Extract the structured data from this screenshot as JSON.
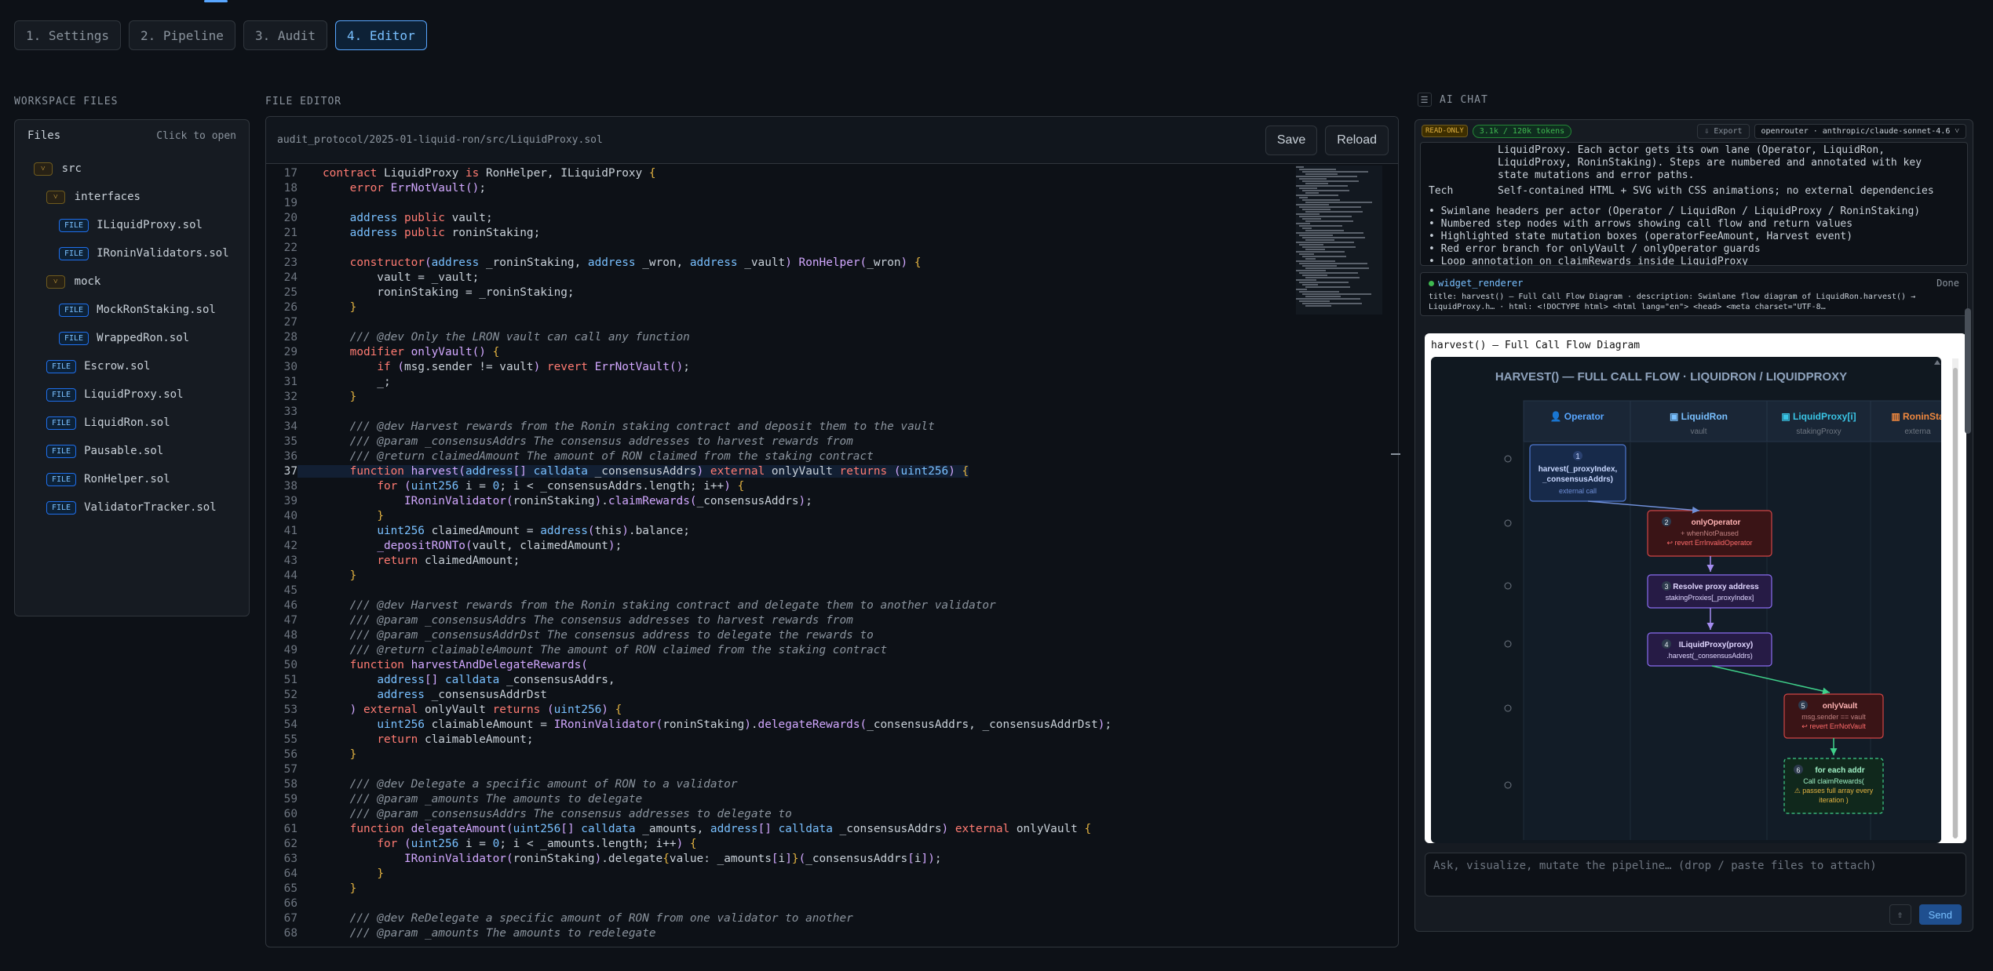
{
  "tabs": [
    "1. Settings",
    "2. Pipeline",
    "3. Audit",
    "4. Editor"
  ],
  "active_tab": 3,
  "workspace": {
    "label": "WORKSPACE FILES",
    "title": "Files",
    "hint": "Click to open",
    "tree": [
      {
        "name": "src",
        "kind": "dir",
        "depth": 0
      },
      {
        "name": "interfaces",
        "kind": "dir",
        "depth": 1
      },
      {
        "name": "ILiquidProxy.sol",
        "kind": "file",
        "depth": 2
      },
      {
        "name": "IRoninValidators.sol",
        "kind": "file",
        "depth": 2
      },
      {
        "name": "mock",
        "kind": "dir",
        "depth": 1
      },
      {
        "name": "MockRonStaking.sol",
        "kind": "file",
        "depth": 2
      },
      {
        "name": "WrappedRon.sol",
        "kind": "file",
        "depth": 2
      },
      {
        "name": "Escrow.sol",
        "kind": "file",
        "depth": 1
      },
      {
        "name": "LiquidProxy.sol",
        "kind": "file",
        "depth": 1
      },
      {
        "name": "LiquidRon.sol",
        "kind": "file",
        "depth": 1
      },
      {
        "name": "Pausable.sol",
        "kind": "file",
        "depth": 1
      },
      {
        "name": "RonHelper.sol",
        "kind": "file",
        "depth": 1
      },
      {
        "name": "ValidatorTracker.sol",
        "kind": "file",
        "depth": 1
      }
    ],
    "file_badge": "FILE",
    "dir_badge": "˅"
  },
  "editor": {
    "label": "FILE EDITOR",
    "path": "audit_protocol/2025-01-liquid-ron/src/LiquidProxy.sol",
    "save": "Save",
    "reload": "Reload",
    "current_line": 37,
    "lines": [
      {
        "n": 17,
        "t": "contract LiquidProxy is RonHelper, ILiquidProxy {"
      },
      {
        "n": 18,
        "t": "    error ErrNotVault();"
      },
      {
        "n": 19,
        "t": ""
      },
      {
        "n": 20,
        "t": "    address public vault;"
      },
      {
        "n": 21,
        "t": "    address public roninStaking;"
      },
      {
        "n": 22,
        "t": ""
      },
      {
        "n": 23,
        "t": "    constructor(address _roninStaking, address _wron, address _vault) RonHelper(_wron) {"
      },
      {
        "n": 24,
        "t": "        vault = _vault;"
      },
      {
        "n": 25,
        "t": "        roninStaking = _roninStaking;"
      },
      {
        "n": 26,
        "t": "    }"
      },
      {
        "n": 27,
        "t": ""
      },
      {
        "n": 28,
        "t": "    /// @dev Only the LRON vault can call any function"
      },
      {
        "n": 29,
        "t": "    modifier onlyVault() {"
      },
      {
        "n": 30,
        "t": "        if (msg.sender != vault) revert ErrNotVault();"
      },
      {
        "n": 31,
        "t": "        _;"
      },
      {
        "n": 32,
        "t": "    }"
      },
      {
        "n": 33,
        "t": ""
      },
      {
        "n": 34,
        "t": "    /// @dev Harvest rewards from the Ronin staking contract and deposit them to the vault"
      },
      {
        "n": 35,
        "t": "    /// @param _consensusAddrs The consensus addresses to harvest rewards from"
      },
      {
        "n": 36,
        "t": "    /// @return claimedAmount The amount of RON claimed from the staking contract"
      },
      {
        "n": 37,
        "t": "    function harvest(address[] calldata _consensusAddrs) external onlyVault returns (uint256) {"
      },
      {
        "n": 38,
        "t": "        for (uint256 i = 0; i < _consensusAddrs.length; i++) {"
      },
      {
        "n": 39,
        "t": "            IRoninValidator(roninStaking).claimRewards(_consensusAddrs);"
      },
      {
        "n": 40,
        "t": "        }"
      },
      {
        "n": 41,
        "t": "        uint256 claimedAmount = address(this).balance;"
      },
      {
        "n": 42,
        "t": "        _depositRONTo(vault, claimedAmount);"
      },
      {
        "n": 43,
        "t": "        return claimedAmount;"
      },
      {
        "n": 44,
        "t": "    }"
      },
      {
        "n": 45,
        "t": ""
      },
      {
        "n": 46,
        "t": "    /// @dev Harvest rewards from the Ronin staking contract and delegate them to another validator"
      },
      {
        "n": 47,
        "t": "    /// @param _consensusAddrs The consensus addresses to harvest rewards from"
      },
      {
        "n": 48,
        "t": "    /// @param _consensusAddrDst The consensus address to delegate the rewards to"
      },
      {
        "n": 49,
        "t": "    /// @return claimableAmount The amount of RON claimed from the staking contract"
      },
      {
        "n": 50,
        "t": "    function harvestAndDelegateRewards("
      },
      {
        "n": 51,
        "t": "        address[] calldata _consensusAddrs,"
      },
      {
        "n": 52,
        "t": "        address _consensusAddrDst"
      },
      {
        "n": 53,
        "t": "    ) external onlyVault returns (uint256) {"
      },
      {
        "n": 54,
        "t": "        uint256 claimableAmount = IRoninValidator(roninStaking).delegateRewards(_consensusAddrs, _consensusAddrDst);"
      },
      {
        "n": 55,
        "t": "        return claimableAmount;"
      },
      {
        "n": 56,
        "t": "    }"
      },
      {
        "n": 57,
        "t": ""
      },
      {
        "n": 58,
        "t": "    /// @dev Delegate a specific amount of RON to a validator"
      },
      {
        "n": 59,
        "t": "    /// @param _amounts The amounts to delegate"
      },
      {
        "n": 60,
        "t": "    /// @param _consensusAddrs The consensus addresses to delegate to"
      },
      {
        "n": 61,
        "t": "    function delegateAmount(uint256[] calldata _amounts, address[] calldata _consensusAddrs) external onlyVault {"
      },
      {
        "n": 62,
        "t": "        for (uint256 i = 0; i < _amounts.length; i++) {"
      },
      {
        "n": 63,
        "t": "            IRoninValidator(roninStaking).delegate{value: _amounts[i]}(_consensusAddrs[i]);"
      },
      {
        "n": 64,
        "t": "        }"
      },
      {
        "n": 65,
        "t": "    }"
      },
      {
        "n": 66,
        "t": ""
      },
      {
        "n": 67,
        "t": "    /// @dev ReDelegate a specific amount of RON from one validator to another"
      },
      {
        "n": 68,
        "t": "    /// @param _amounts The amounts to redelegate"
      }
    ]
  },
  "chat": {
    "label": "AI CHAT",
    "read_only": "READ-ONLY",
    "tokens": "3.1k / 120k tokens",
    "export": "⇩ Export",
    "model": "openrouter · anthropic/claude-sonnet-4.6 ˅",
    "message": {
      "lines": [
        "LiquidProxy. Each actor gets its own lane (Operator, LiquidRon,",
        "LiquidProxy, RoninStaking). Steps are numbered and annotated with key",
        "state mutations and error paths."
      ],
      "tech_key": "Tech",
      "tech_val": "Self-contained HTML + SVG with CSS animations; no external dependencies",
      "bullets": [
        "Swimlane headers per actor (Operator / LiquidRon / LiquidProxy / RoninStaking)",
        "Numbered step nodes with arrows showing call flow and return values",
        "Highlighted state mutation boxes (operatorFeeAmount, Harvest event)",
        "Red error branch for onlyVault / onlyOperator guards",
        "Loop annotation on claimRewards inside LiquidProxy"
      ]
    },
    "tool": {
      "name": "widget_renderer",
      "status": "Done",
      "line1": "title: harvest() — Full Call Flow Diagram · description: Swimlane flow diagram of LiquidRon.harvest() →",
      "line2": "LiquidProxy.h… · html: <!DOCTYPE html> <html lang=\"en\"> <head> <meta charset=\"UTF-8…"
    },
    "widget": {
      "title": "harvest() — Full Call Flow Diagram",
      "diagram_title": "HARVEST() — FULL CALL FLOW · LIQUIDRON / LIQUIDPROXY",
      "lanes": [
        {
          "name": "👤 Operator",
          "sub": ""
        },
        {
          "name": "▣ LiquidRon",
          "sub": "vault"
        },
        {
          "name": "▣ LiquidProxy[i]",
          "sub": "stakingProxy"
        },
        {
          "name": "▥ RoninSta",
          "sub": "externa"
        }
      ],
      "steps": [
        {
          "num": "1",
          "l1": "harvest(_proxyIndex,",
          "l2": "_consensusAddrs)",
          "l3": "external call"
        },
        {
          "num": "2",
          "l1": "onlyOperator",
          "l2": "+ whenNotPaused",
          "l3": "↩ revert ErrInvalidOperator"
        },
        {
          "num": "3",
          "l1": "Resolve proxy address",
          "l2": "stakingProxies[_proxyIndex]",
          "l3": ""
        },
        {
          "num": "4",
          "l1": "ILiquidProxy(proxy)",
          "l2": ".harvest(_consensusAddrs)",
          "l3": ""
        },
        {
          "num": "5",
          "l1": "onlyVault",
          "l2": "msg.sender == vault",
          "l3": "↩ revert ErrNotVault"
        },
        {
          "num": "6",
          "l1": "for each addr",
          "l2": "Call claimRewards(",
          "l3": "⚠ passes full array every",
          "l4": "iteration )"
        }
      ]
    },
    "input_placeholder": "Ask, visualize, mutate the pipeline… (drop / paste files to attach)",
    "attach": "⇧",
    "send": "Send"
  }
}
